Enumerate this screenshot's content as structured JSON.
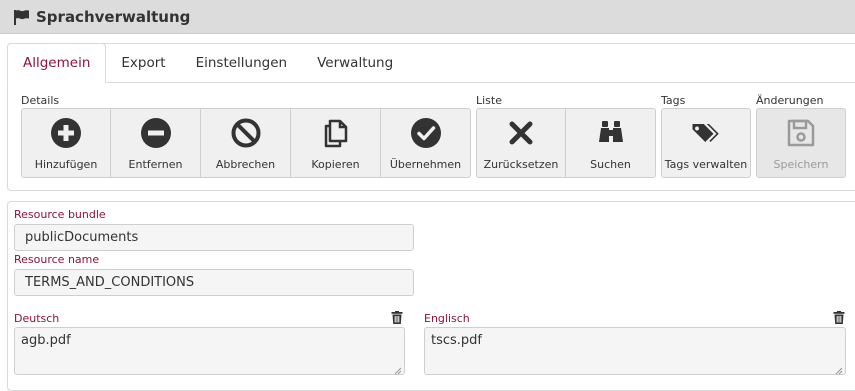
{
  "titlebar": {
    "title": "Sprachverwaltung",
    "icon": "flag-icon"
  },
  "tabs": [
    "Allgemein",
    "Export",
    "Einstellungen",
    "Verwaltung"
  ],
  "groups": {
    "details": "Details",
    "liste": "Liste",
    "tags": "Tags",
    "aenderungen": "Änderungen"
  },
  "buttons": {
    "hinzufuegen": "Hinzufügen",
    "entfernen": "Entfernen",
    "abbrechen": "Abbrechen",
    "kopieren": "Kopieren",
    "uebernehmen": "Übernehmen",
    "zuruecksetzen": "Zurücksetzen",
    "suchen": "Suchen",
    "tags_verwalten": "Tags verwalten",
    "speichern": "Speichern"
  },
  "form": {
    "resource_bundle_label": "Resource bundle",
    "resource_bundle_value": "publicDocuments",
    "resource_name_label": "Resource name",
    "resource_name_value": "TERMS_AND_CONDITIONS",
    "deutsch_label": "Deutsch",
    "deutsch_value": "agb.pdf",
    "englisch_label": "Englisch",
    "englisch_value": "tscs.pdf"
  },
  "colors": {
    "accent": "#8a1538",
    "icon": "#333333",
    "disabled": "#9a9a9a"
  }
}
